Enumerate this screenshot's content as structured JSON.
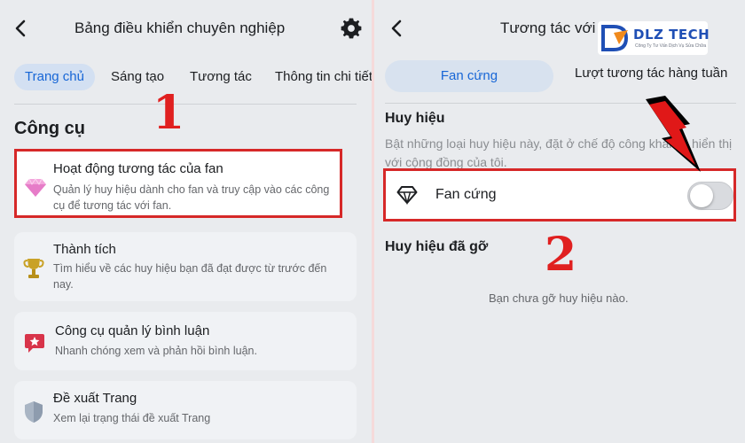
{
  "left": {
    "header_title": "Bảng điều khiển chuyên nghiệp",
    "tabs": [
      {
        "label": "Trang chủ"
      },
      {
        "label": "Sáng tạo"
      },
      {
        "label": "Tương tác"
      },
      {
        "label": "Thông tin chi tiết"
      }
    ],
    "section_title": "Công cụ",
    "annotation_number": "1",
    "cards": [
      {
        "title": "Hoạt động tương tác của fan",
        "desc": "Quản lý huy hiệu dành cho fan và truy cập vào các công cụ để tương tác với fan.",
        "icon": "diamond-icon"
      },
      {
        "title": "Thành tích",
        "desc": "Tìm hiểu về các huy hiệu bạn đã đạt được từ trước đến nay.",
        "icon": "trophy-icon"
      },
      {
        "title": "Công cụ quản lý bình luận",
        "desc": "Nhanh chóng xem và phản hồi bình luận.",
        "icon": "comment-star-icon"
      },
      {
        "title": "Đề xuất Trang",
        "desc": "Xem lại trạng thái đề xuất Trang",
        "icon": "shield-icon"
      }
    ]
  },
  "right": {
    "header_title": "Tương tác với fa",
    "segments": [
      {
        "label": "Fan cứng"
      },
      {
        "label": "Lượt tương tác hàng tuần"
      }
    ],
    "badges_title": "Huy hiệu",
    "badges_desc": "Bật những loại huy hiệu này, đặt ở chế độ công khai và hiển thị với cộng đồng của tôi.",
    "toggle_row": {
      "label": "Fan cứng",
      "enabled": false
    },
    "annotation_number": "2",
    "removed_title": "Huy hiệu đã gỡ",
    "removed_empty": "Bạn chưa gỡ huy hiệu nào."
  },
  "watermark": {
    "name": "DLZ TECH",
    "tagline": "Công Ty Tư Vấn Dịch Vụ Sửa Chữa"
  },
  "colors": {
    "accent": "#1766d6",
    "annotation": "#e02020",
    "background": "#e9ebee"
  }
}
